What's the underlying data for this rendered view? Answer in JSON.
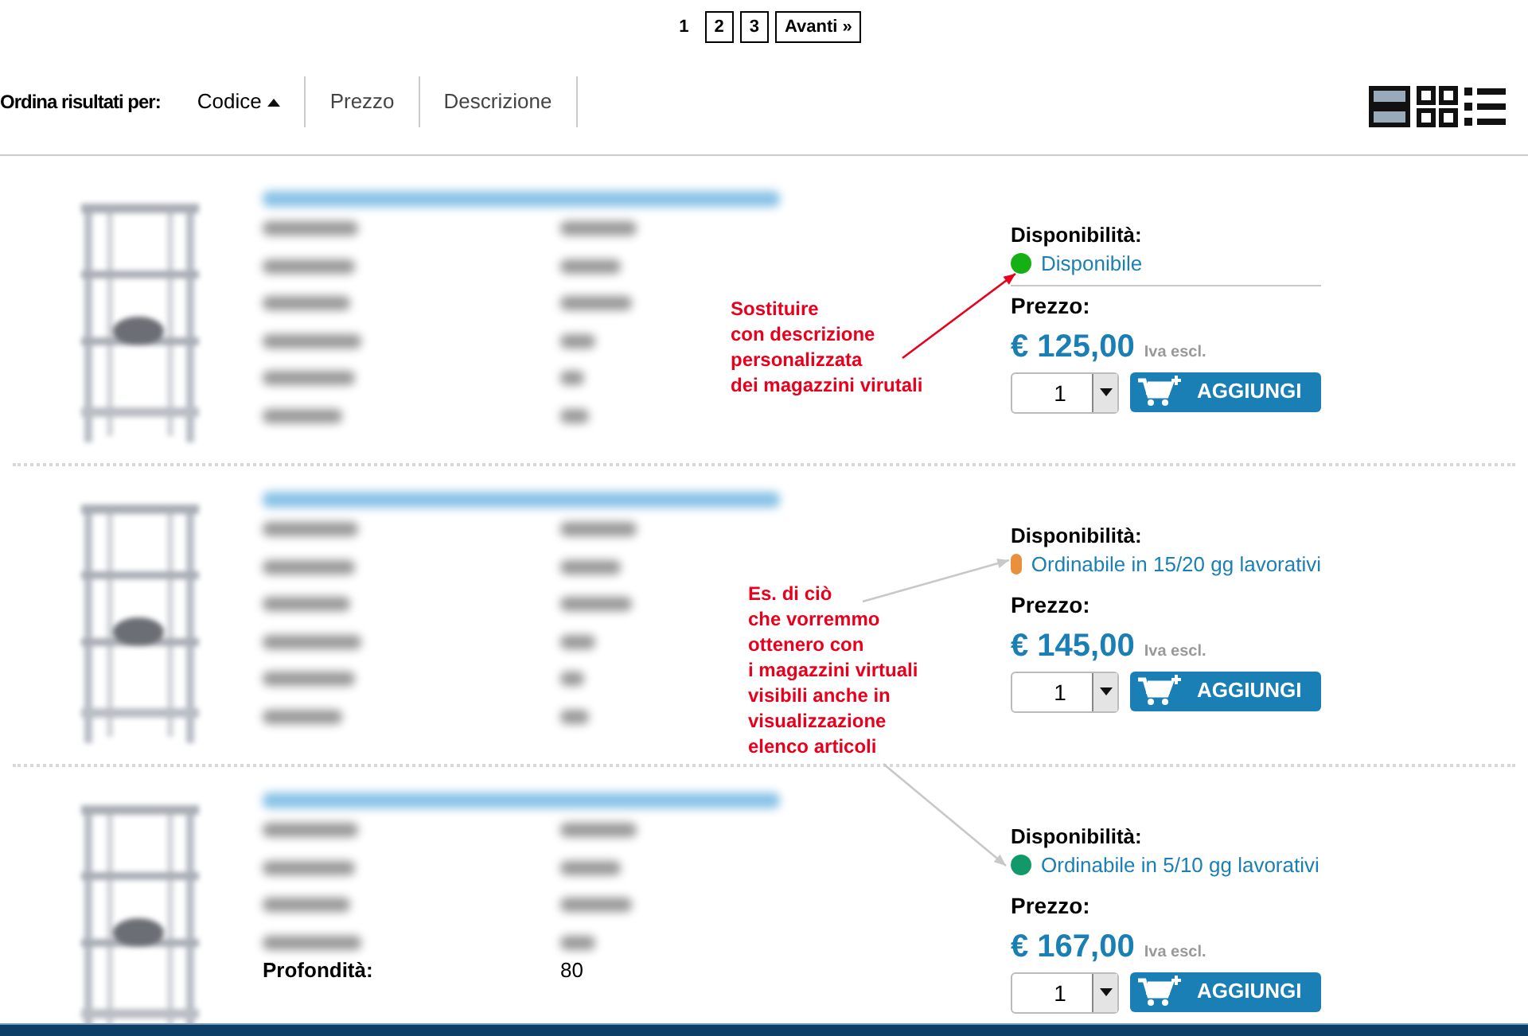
{
  "pagination": {
    "pages": [
      {
        "label": "1",
        "selected": true
      },
      {
        "label": "2",
        "selected": false
      },
      {
        "label": "3",
        "selected": false
      }
    ],
    "next": "Avanti »"
  },
  "sort_bar": {
    "label": "Ordina risultati per:",
    "options": [
      {
        "label": "Codice",
        "selected": true
      },
      {
        "label": "Prezzo",
        "selected": false
      },
      {
        "label": "Descrizione",
        "selected": false
      }
    ]
  },
  "views": [
    {
      "kind": "rows",
      "selected": true
    },
    {
      "kind": "grid",
      "selected": false
    },
    {
      "kind": "list",
      "selected": false
    }
  ],
  "products": [
    {
      "availability_label": "Disponibilità:",
      "status": "Disponibile",
      "color": "#14b014",
      "divider": true,
      "price_label": "Prezzo:",
      "price": "€ 125,00",
      "tax_note": "Iva escl.",
      "quantity": "1",
      "add_button": "AGGIUNGI"
    },
    {
      "availability_label": "Disponibilità:",
      "status": "Ordinabile in 15/20 gg lavorativi",
      "color": "#e8903c",
      "divider": false,
      "price_label": "Prezzo:",
      "price": "€ 145,00",
      "tax_note": "Iva escl.",
      "quantity": "1",
      "add_button": "AGGIUNGI"
    },
    {
      "specs": [
        {
          "label": "Profondità:",
          "value": "80"
        }
      ],
      "availability_label": "Disponibilità:",
      "status": "Ordinabile in 5/10 gg lavorativi",
      "color": "#12996a",
      "divider": false,
      "price_label": "Prezzo:",
      "price": "€ 167,00",
      "tax_note": "Iva escl.",
      "quantity": "1",
      "add_button": "AGGIUNGI"
    }
  ],
  "annotations": [
    {
      "text": "Sostituire\ncon descrizione\npersonalizzata\ndei magazzini virutali",
      "kind": "red"
    },
    {
      "text": "Es. di ciò\nche vorremmo\nottenero con\ni magazzini virtuali\nvisibili anche in\nvisualizzazione\nelenco articoli",
      "kind": "gray"
    }
  ]
}
